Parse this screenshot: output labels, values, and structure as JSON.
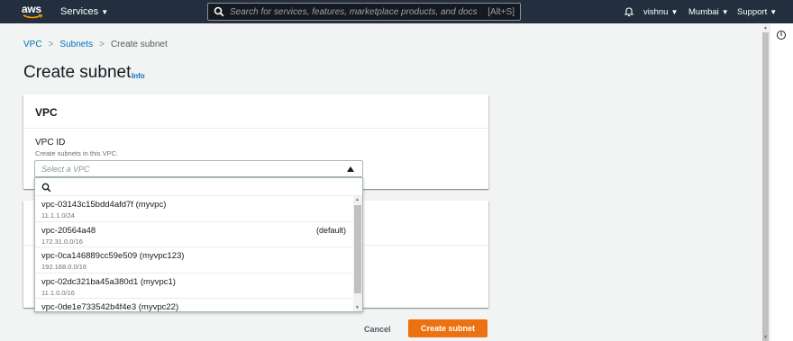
{
  "topnav": {
    "logo_text": "aws",
    "services_label": "Services",
    "search_placeholder": "Search for services, features, marketplace products, and docs",
    "search_shortcut": "[Alt+S]",
    "user": "vishnu",
    "region": "Mumbai",
    "support": "Support",
    "caret": "▼"
  },
  "breadcrumb": {
    "items": [
      "VPC",
      "Subnets",
      "Create subnet"
    ],
    "separator": ">"
  },
  "page": {
    "title": "Create subnet",
    "info_link": "Info"
  },
  "vpc_panel": {
    "heading": "VPC",
    "field_label": "VPC ID",
    "field_description": "Create subnets in this VPC.",
    "select_placeholder": "Select a VPC"
  },
  "dropdown": {
    "options": [
      {
        "name": "vpc-03143c15bdd4afd7f (myvpc)",
        "cidr": "11.1.1.0/24",
        "tag": ""
      },
      {
        "name": "vpc-20564a48",
        "cidr": "172.31.0.0/16",
        "tag": "(default)"
      },
      {
        "name": "vpc-0ca146889cc59e509 (myvpc123)",
        "cidr": "192.168.0.0/16",
        "tag": ""
      },
      {
        "name": "vpc-02dc321ba45a380d1 (myvpc1)",
        "cidr": "11.1.0.0/16",
        "tag": ""
      },
      {
        "name": "vpc-0de1e733542b4f4e3 (myvpc22)",
        "cidr": "",
        "tag": ""
      }
    ]
  },
  "actions": {
    "cancel_label": "Cancel",
    "create_label": "Create subnet"
  },
  "colors": {
    "nav_bg": "#232f3e",
    "link": "#0073bb",
    "primary_button": "#ec7211",
    "page_bg": "#f2f3f3"
  },
  "icons": {
    "search": "search-icon",
    "bell": "bell-icon",
    "info": "info-circle-icon",
    "select_caret": "caret-up-icon"
  }
}
